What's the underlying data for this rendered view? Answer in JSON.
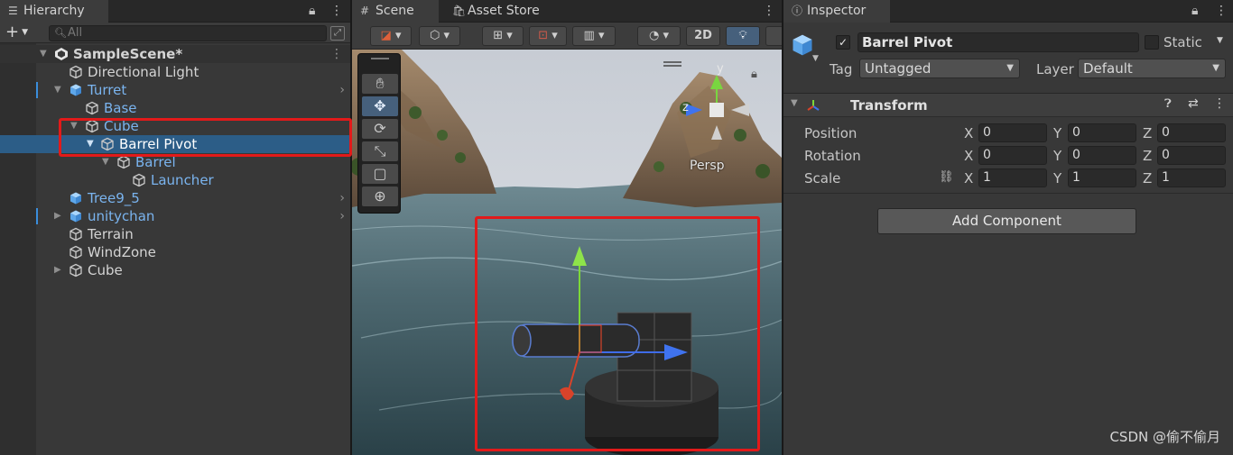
{
  "hierarchy": {
    "tab_title": "Hierarchy",
    "add_label": "+",
    "search_placeholder": "All",
    "scene_name": "SampleScene*",
    "items": [
      {
        "label": "Directional Light"
      },
      {
        "label": "Turret"
      },
      {
        "label": "Base"
      },
      {
        "label": "Cube"
      },
      {
        "label": "Barrel Pivot"
      },
      {
        "label": "Barrel"
      },
      {
        "label": "Launcher"
      },
      {
        "label": "Tree9_5"
      },
      {
        "label": "unitychan"
      },
      {
        "label": "Terrain"
      },
      {
        "label": "WindZone"
      },
      {
        "label": "Cube"
      }
    ]
  },
  "scene": {
    "tabs": [
      {
        "label": "Scene"
      },
      {
        "label": "Asset Store"
      }
    ],
    "toolbar": {
      "mode_2d": "2D"
    },
    "gizmo": {
      "y_label": "y",
      "z_label": "z",
      "projection_label": "Persp"
    }
  },
  "inspector": {
    "tab_title": "Inspector",
    "object_name": "Barrel Pivot",
    "static_label": "Static",
    "tag_label": "Tag",
    "tag_value": "Untagged",
    "layer_label": "Layer",
    "layer_value": "Default",
    "component_title": "Transform",
    "transform": {
      "position_label": "Position",
      "rotation_label": "Rotation",
      "scale_label": "Scale",
      "axes": {
        "x": "X",
        "y": "Y",
        "z": "Z"
      },
      "position": {
        "x": "0",
        "y": "0",
        "z": "0"
      },
      "rotation": {
        "x": "0",
        "y": "0",
        "z": "0"
      },
      "scale": {
        "x": "1",
        "y": "1",
        "z": "1"
      }
    },
    "add_component_label": "Add Component"
  },
  "watermark": "CSDN @偷不偷月",
  "colors": {
    "selection": "#2c5d87",
    "annotation": "#e21a1a",
    "hierarchy_blue": "#7ab4ef"
  }
}
